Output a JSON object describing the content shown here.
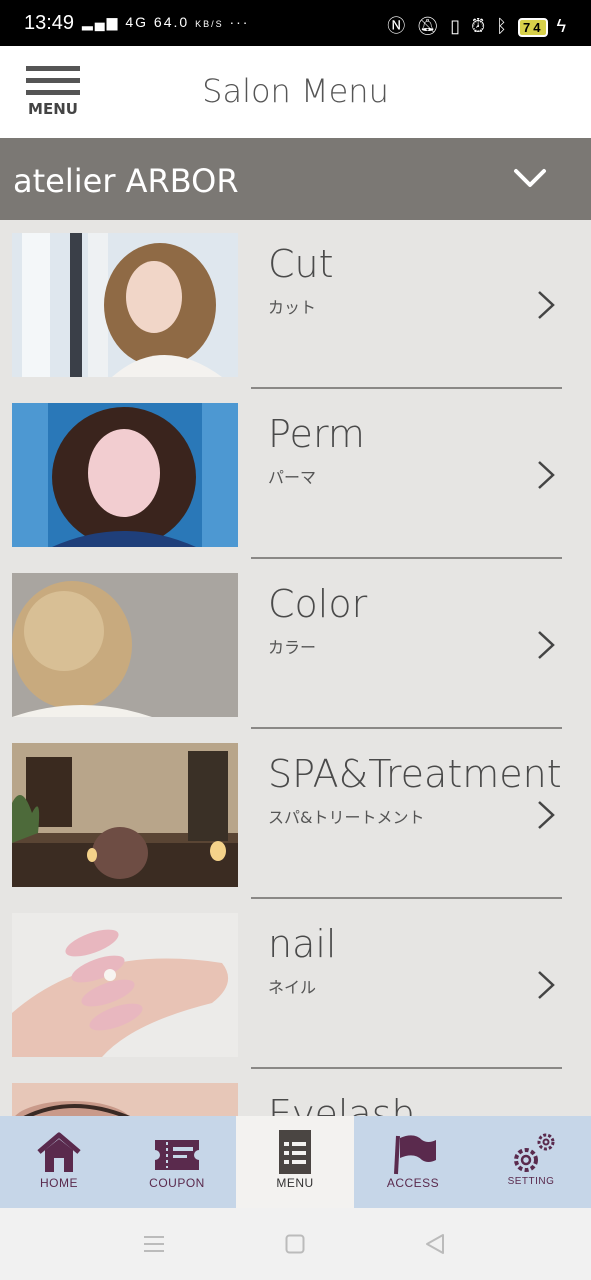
{
  "status_bar": {
    "time": "13:49",
    "network": "4G",
    "speed_value": "64.0",
    "speed_unit": "KB/S",
    "dots": "···",
    "battery": "74"
  },
  "header": {
    "menu_label": "MENU",
    "title": "Salon Menu"
  },
  "salon": {
    "name": "atelier ARBOR"
  },
  "menu_items": [
    {
      "title": "Cut",
      "subtitle": "カット",
      "photo": "woman-wavy-bob-window"
    },
    {
      "title": "Perm",
      "subtitle": "パーマ",
      "photo": "woman-curly-hair-blue-wall"
    },
    {
      "title": "Color",
      "subtitle": "カラー",
      "photo": "blonde-bob-from-behind"
    },
    {
      "title": "SPA&Treatment",
      "subtitle": "スパ&トリートメント",
      "photo": "salon-interior-chair"
    },
    {
      "title": "nail",
      "subtitle": "ネイル",
      "photo": "pink-nails-hand"
    },
    {
      "title": "Eyelash",
      "subtitle": "",
      "photo": "eye-closeup"
    }
  ],
  "tabs": [
    {
      "label": "HOME",
      "icon": "home-icon"
    },
    {
      "label": "COUPON",
      "icon": "ticket-icon"
    },
    {
      "label": "MENU",
      "icon": "menu-list-icon"
    },
    {
      "label": "ACCESS",
      "icon": "flag-icon"
    },
    {
      "label": "SETTING",
      "icon": "gear-icon"
    }
  ],
  "colors": {
    "salon_bar": "#7b7874",
    "background": "#e6e5e3",
    "tab_bar": "#c6d6e8",
    "tab_icon": "#5a2a4d"
  }
}
